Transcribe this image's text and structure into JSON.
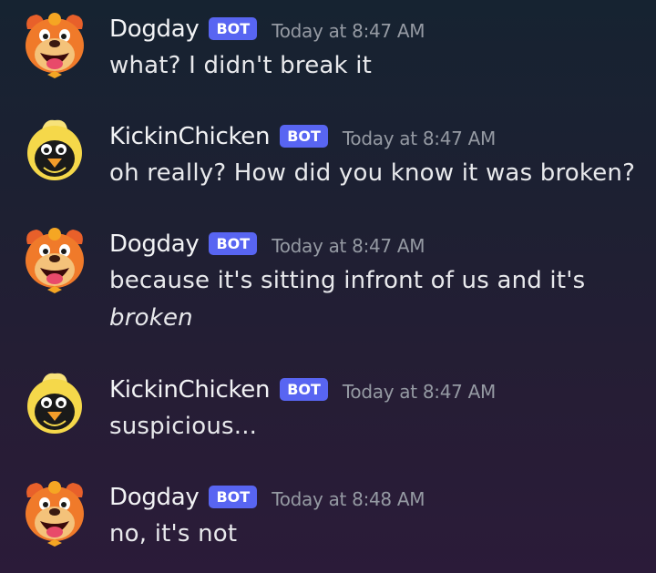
{
  "messages": [
    {
      "author": "Dogday",
      "avatar": "dogday-avatar-icon",
      "badge": "BOT",
      "timestamp": "Today at 8:47 AM",
      "text": "what? I didn't break it"
    },
    {
      "author": "KickinChicken",
      "avatar": "kickinchicken-avatar-icon",
      "badge": "BOT",
      "timestamp": "Today at 8:47 AM",
      "text": "oh really? How did you know it was broken?"
    },
    {
      "author": "Dogday",
      "avatar": "dogday-avatar-icon",
      "badge": "BOT",
      "timestamp": "Today at 8:47 AM",
      "text": "because it's sitting infront of us and it's",
      "text_italic": "broken"
    },
    {
      "author": "KickinChicken",
      "avatar": "kickinchicken-avatar-icon",
      "badge": "BOT",
      "timestamp": "Today at 8:47 AM",
      "text": "suspicious..."
    },
    {
      "author": "Dogday",
      "avatar": "dogday-avatar-icon",
      "badge": "BOT",
      "timestamp": "Today at 8:48 AM",
      "text": "no, it's not"
    }
  ],
  "colors": {
    "badge_background": "#5865f2",
    "username": "#f2f3f5",
    "timestamp": "#959aa3",
    "message_text": "#e8e9ec",
    "dogday_orange": "#f07a2a",
    "kickinchicken_yellow": "#f5d84a"
  }
}
